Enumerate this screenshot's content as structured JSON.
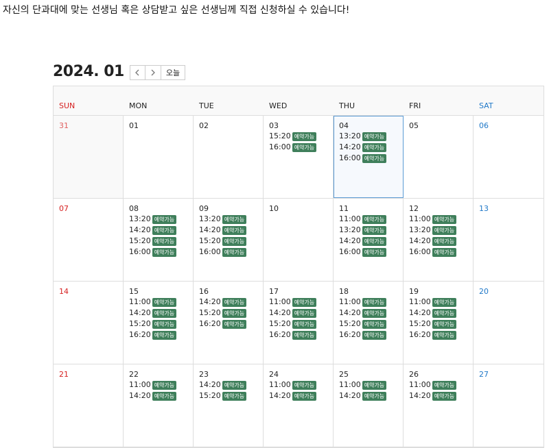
{
  "intro_text": "자신의 단과대에 맞는 선생님 혹은 상담받고 싶은 선생님께 직접 신청하실 수 있습니다!",
  "toolbar": {
    "month_title": "2024. 01",
    "prev_icon": "chevron-left-icon",
    "next_icon": "chevron-right-icon",
    "today_label": "오늘"
  },
  "days_of_week": [
    "SUN",
    "MON",
    "TUE",
    "WED",
    "THU",
    "FRI",
    "SAT"
  ],
  "badge_label": "예약가능",
  "colors": {
    "sunday": "#d62020",
    "saturday": "#1f78c8",
    "badge": "#3f7f5b",
    "today_border": "#5b9bd5"
  },
  "weeks": [
    [
      {
        "day": "31",
        "other": true,
        "slots": []
      },
      {
        "day": "01",
        "slots": []
      },
      {
        "day": "02",
        "slots": []
      },
      {
        "day": "03",
        "slots": [
          "15:20",
          "16:00"
        ]
      },
      {
        "day": "04",
        "today": true,
        "slots": [
          "13:20",
          "14:20",
          "16:00"
        ]
      },
      {
        "day": "05",
        "slots": []
      },
      {
        "day": "06",
        "slots": []
      }
    ],
    [
      {
        "day": "07",
        "slots": []
      },
      {
        "day": "08",
        "slots": [
          "13:20",
          "14:20",
          "15:20",
          "16:00"
        ]
      },
      {
        "day": "09",
        "slots": [
          "13:20",
          "14:20",
          "15:20",
          "16:00"
        ]
      },
      {
        "day": "10",
        "slots": []
      },
      {
        "day": "11",
        "slots": [
          "11:00",
          "13:20",
          "14:20",
          "16:00"
        ]
      },
      {
        "day": "12",
        "slots": [
          "11:00",
          "13:20",
          "14:20",
          "16:00"
        ]
      },
      {
        "day": "13",
        "slots": []
      }
    ],
    [
      {
        "day": "14",
        "slots": []
      },
      {
        "day": "15",
        "slots": [
          "11:00",
          "14:20",
          "15:20",
          "16:20"
        ]
      },
      {
        "day": "16",
        "slots": [
          "14:20",
          "15:20",
          "16:20"
        ]
      },
      {
        "day": "17",
        "slots": [
          "11:00",
          "14:20",
          "15:20",
          "16:20"
        ]
      },
      {
        "day": "18",
        "slots": [
          "11:00",
          "14:20",
          "15:20",
          "16:20"
        ]
      },
      {
        "day": "19",
        "slots": [
          "11:00",
          "14:20",
          "15:20",
          "16:20"
        ]
      },
      {
        "day": "20",
        "slots": []
      }
    ],
    [
      {
        "day": "21",
        "slots": []
      },
      {
        "day": "22",
        "slots": [
          "11:00",
          "14:20"
        ]
      },
      {
        "day": "23",
        "slots": [
          "14:20",
          "15:20"
        ]
      },
      {
        "day": "24",
        "slots": [
          "11:00",
          "14:20"
        ]
      },
      {
        "day": "25",
        "slots": [
          "11:00",
          "14:20"
        ]
      },
      {
        "day": "26",
        "slots": [
          "11:00",
          "14:20"
        ]
      },
      {
        "day": "27",
        "slots": []
      }
    ]
  ]
}
